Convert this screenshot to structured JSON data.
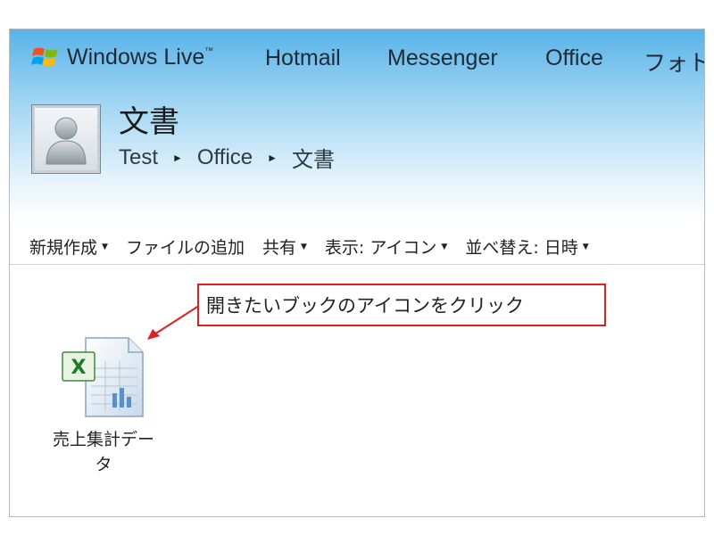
{
  "nav": {
    "brand": "Windows Live",
    "brand_tm": "™",
    "links": [
      "Hotmail",
      "Messenger",
      "Office",
      "フォト"
    ]
  },
  "header": {
    "title": "文書",
    "breadcrumb": [
      "Test",
      "Office",
      "文書"
    ],
    "separator": "►"
  },
  "toolbar": {
    "new": "新規作成",
    "add_files": "ファイルの追加",
    "share": "共有",
    "view": "表示: アイコン",
    "sort": "並べ替え: 日時",
    "caret": "▼"
  },
  "annotation": {
    "text": "開きたいブックのアイコンをクリック",
    "color": "#e02020"
  },
  "files": [
    {
      "name_line1": "売上集計デー",
      "name_line2": "タ",
      "icon": "excel-workbook-icon"
    }
  ],
  "colors": {
    "header_gradient_top": "#58b3e8",
    "header_gradient_mid": "#a8d8f4"
  }
}
